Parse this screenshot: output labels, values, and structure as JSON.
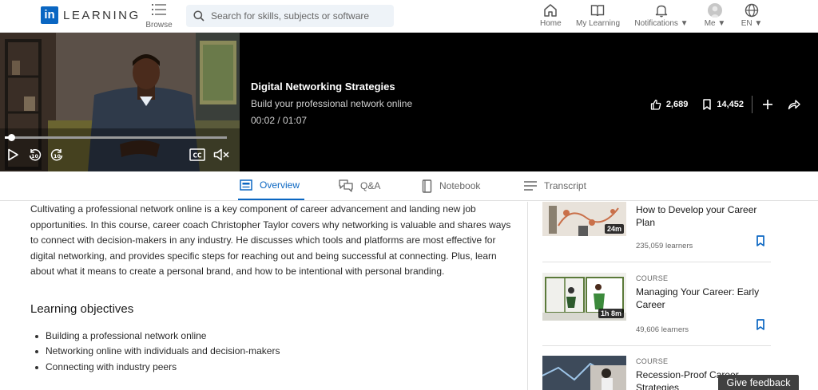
{
  "header": {
    "logo_in": "in",
    "logo_text": "LEARNING",
    "browse_label": "Browse",
    "search_placeholder": "Search for skills, subjects or software",
    "nav": [
      {
        "label": "Home",
        "icon": "home-icon"
      },
      {
        "label": "My Learning",
        "icon": "book-icon"
      },
      {
        "label": "Notifications",
        "icon": "bell-icon"
      },
      {
        "label": "Me",
        "icon": "avatar"
      },
      {
        "label": "EN",
        "icon": "globe-icon"
      }
    ]
  },
  "player": {
    "title": "Digital Networking Strategies",
    "subtitle": "Build your professional network online",
    "time": "00:02 / 01:07",
    "progress": 0.03,
    "likes": "2,689",
    "saves": "14,452"
  },
  "tabs": [
    {
      "label": "Overview",
      "active": true
    },
    {
      "label": "Q&A"
    },
    {
      "label": "Notebook"
    },
    {
      "label": "Transcript"
    }
  ],
  "overview": {
    "description": "Cultivating a professional network online is a key component of career advancement and landing new job opportunities. In this course, career coach Christopher Taylor covers why networking is valuable and shares ways to connect with decision-makers in any industry. He discusses which tools and platforms are most effective for digital networking, and provides specific steps for reaching out and being successful at connecting. Plus, learn about what it means to create a personal brand, and how to be intentional with personal branding.",
    "objectives_title": "Learning objectives",
    "objectives": [
      "Building a professional network online",
      "Networking online with individuals and decision-makers",
      "Connecting with industry peers"
    ]
  },
  "recommendations": [
    {
      "kind": "",
      "title": "How to Develop your Career Plan",
      "duration": "24m",
      "learners": "235,059 learners"
    },
    {
      "kind": "COURSE",
      "title": "Managing Your Career: Early Career",
      "duration": "1h 8m",
      "learners": "49,606 learners"
    },
    {
      "kind": "COURSE",
      "title": "Recession-Proof Career Strategies",
      "duration": "",
      "learners": ""
    }
  ],
  "feedback_label": "Give feedback",
  "colors": {
    "accent": "#0a66c2",
    "player_bg": "#000000"
  }
}
